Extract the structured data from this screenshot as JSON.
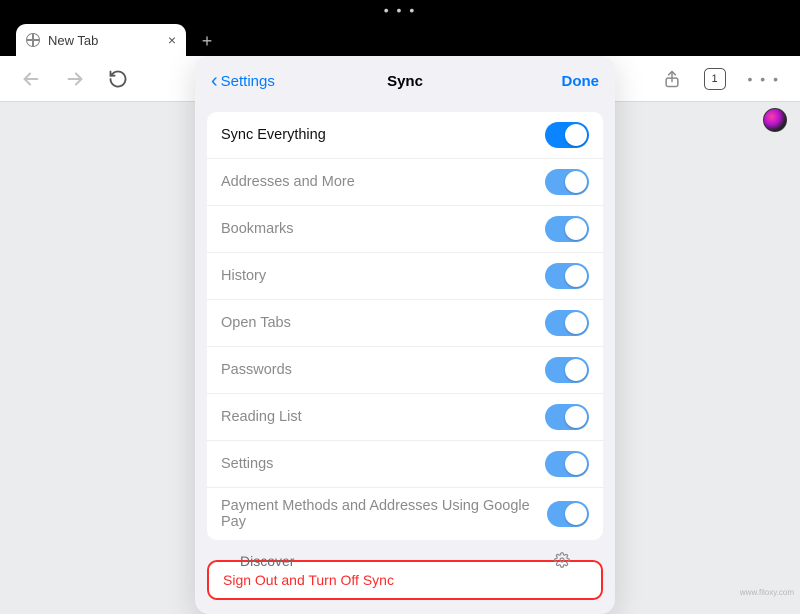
{
  "status": {
    "dots": "• • •"
  },
  "tab": {
    "title": "New Tab",
    "close": "×",
    "add": "+"
  },
  "toolbar": {
    "tabs_count": "1",
    "menu_dots": "• • •"
  },
  "modal": {
    "back_label": "Settings",
    "title": "Sync",
    "done_label": "Done",
    "items": {
      "0": {
        "label": "Sync Everything"
      },
      "1": {
        "label": "Addresses and More"
      },
      "2": {
        "label": "Bookmarks"
      },
      "3": {
        "label": "History"
      },
      "4": {
        "label": "Open Tabs"
      },
      "5": {
        "label": "Passwords"
      },
      "6": {
        "label": "Reading List"
      },
      "7": {
        "label": "Settings"
      },
      "8": {
        "label": "Payment Methods and Addresses Using Google Pay"
      }
    },
    "signout_label": "Sign Out and Turn Off Sync"
  },
  "discover": {
    "label": "Discover"
  },
  "watermark": "www.filoxy.com"
}
